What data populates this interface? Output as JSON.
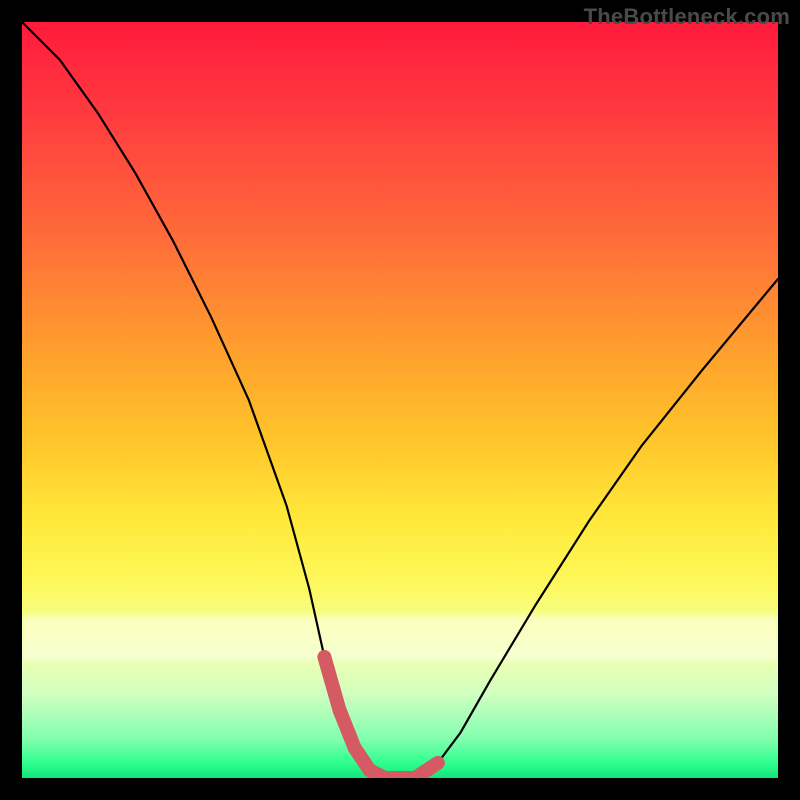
{
  "watermark": "TheBottleneck.com",
  "chart_data": {
    "type": "line",
    "title": "",
    "xlabel": "",
    "ylabel": "",
    "xlim": [
      0,
      100
    ],
    "ylim": [
      0,
      100
    ],
    "grid": false,
    "series": [
      {
        "name": "bottleneck-curve",
        "color": "#000000",
        "x": [
          0,
          5,
          10,
          15,
          20,
          25,
          30,
          35,
          38,
          40,
          42,
          44,
          46,
          48,
          50,
          52,
          55,
          58,
          62,
          68,
          75,
          82,
          90,
          100
        ],
        "y": [
          100,
          95,
          88,
          80,
          71,
          61,
          50,
          36,
          25,
          16,
          9,
          4,
          1,
          0,
          0,
          0,
          2,
          6,
          13,
          23,
          34,
          44,
          54,
          66
        ]
      },
      {
        "name": "optimal-range",
        "color": "#d45a63",
        "x": [
          40,
          42,
          44,
          46,
          48,
          50,
          52,
          55
        ],
        "y": [
          16,
          9,
          4,
          1,
          0,
          0,
          0,
          2
        ]
      }
    ],
    "colors": {
      "gradient_top": "#ff1a3c",
      "gradient_mid": "#ffe93a",
      "gradient_bottom": "#12e67b",
      "curve": "#000000",
      "optimal": "#d45a63",
      "background": "#000000"
    }
  }
}
